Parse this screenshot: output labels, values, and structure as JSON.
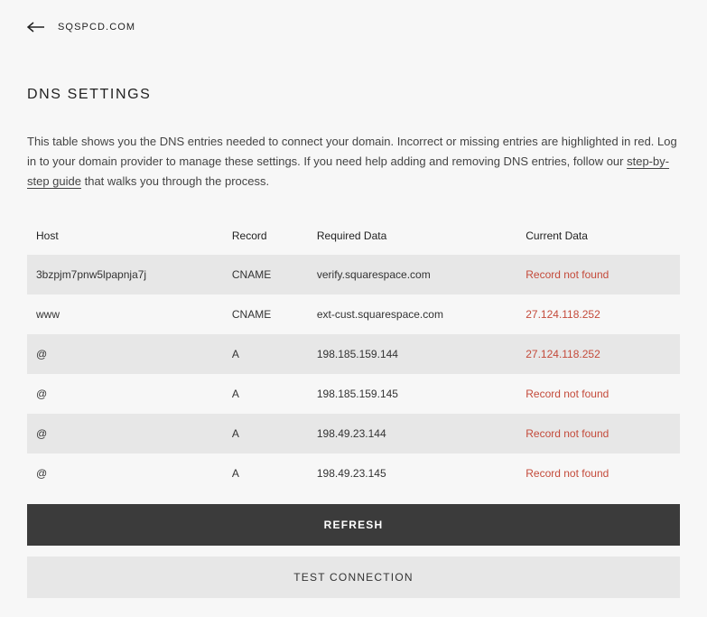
{
  "breadcrumb": "SQSPCD.COM",
  "page_title": "DNS SETTINGS",
  "description": {
    "part1": "This table shows you the DNS entries needed to connect your domain. Incorrect or missing entries are highlighted in red. Log in to your domain provider to manage these settings. If you need help adding and removing DNS entries, follow our ",
    "link_text": "step-by-step guide",
    "part2": " that walks you through the process."
  },
  "table": {
    "headers": {
      "host": "Host",
      "record": "Record",
      "required": "Required Data",
      "current": "Current Data"
    },
    "rows": [
      {
        "host": "3bzpjm7pnw5lpapnja7j",
        "record": "CNAME",
        "required": "verify.squarespace.com",
        "current": "Record not found",
        "error": true
      },
      {
        "host": "www",
        "record": "CNAME",
        "required": "ext-cust.squarespace.com",
        "current": "27.124.118.252",
        "error": true
      },
      {
        "host": "@",
        "record": "A",
        "required": "198.185.159.144",
        "current": "27.124.118.252",
        "error": true
      },
      {
        "host": "@",
        "record": "A",
        "required": "198.185.159.145",
        "current": "Record not found",
        "error": true
      },
      {
        "host": "@",
        "record": "A",
        "required": "198.49.23.144",
        "current": "Record not found",
        "error": true
      },
      {
        "host": "@",
        "record": "A",
        "required": "198.49.23.145",
        "current": "Record not found",
        "error": true
      }
    ]
  },
  "buttons": {
    "refresh": "REFRESH",
    "test": "TEST CONNECTION"
  }
}
